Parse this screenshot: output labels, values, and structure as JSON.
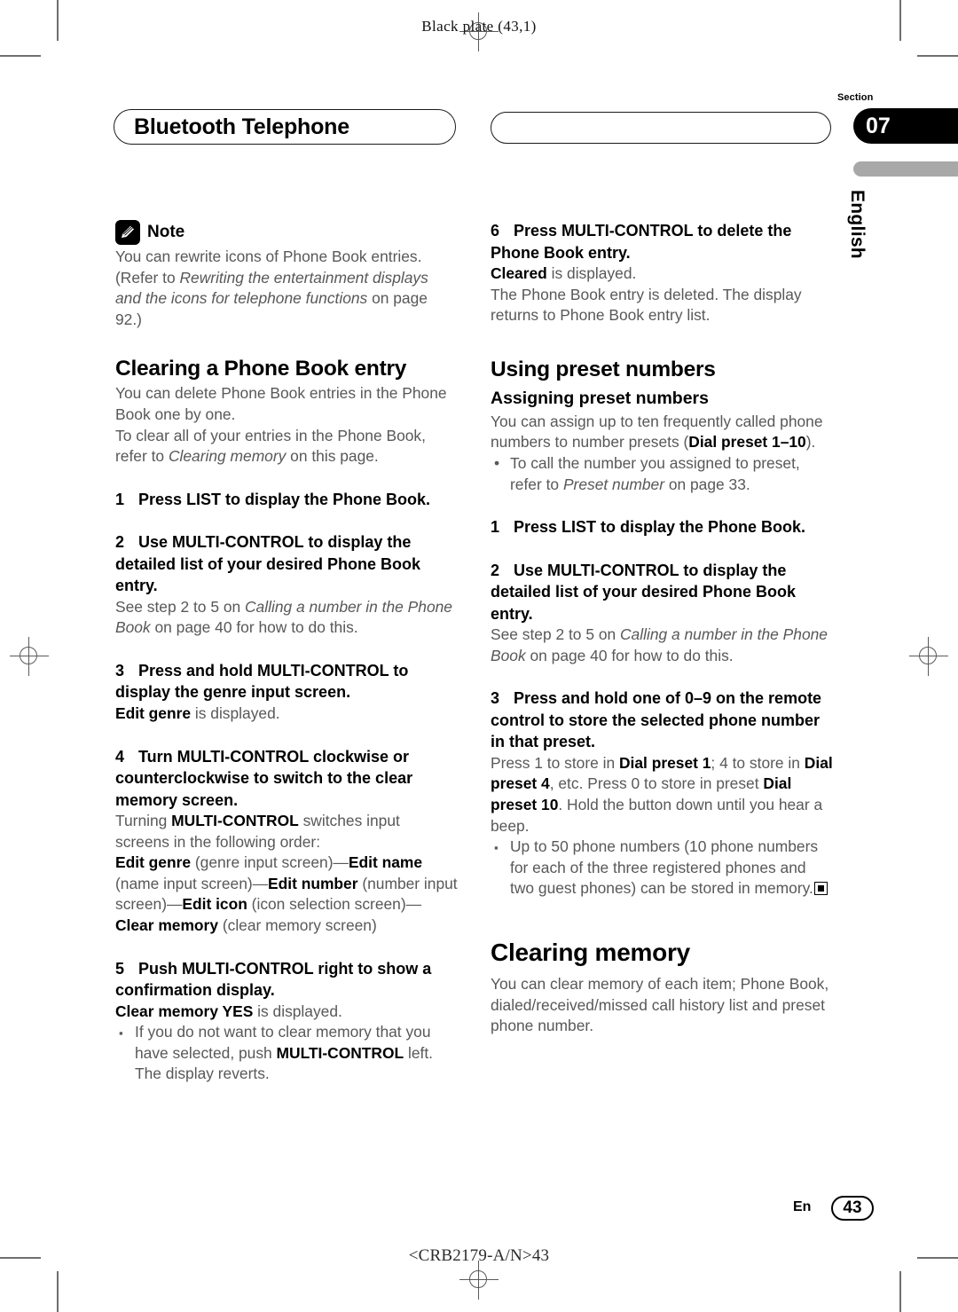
{
  "print_marks": {
    "plate_slug": "Black plate (43,1)",
    "footer_code": "<CRB2179-A/N>43"
  },
  "header": {
    "chapter_title": "Bluetooth Telephone",
    "section_label": "Section",
    "section_number": "07",
    "language": "English"
  },
  "left_column": {
    "note": {
      "icon": "pencil-note-icon",
      "label": "Note",
      "line1": "You can rewrite icons of Phone Book entries.",
      "line2_pre": "(Refer to ",
      "line2_italic": "Rewriting the entertainment displays and the icons for telephone functions",
      "line2_post": " on page 92.)"
    },
    "section_heading": "Clearing a Phone Book entry",
    "intro1": "You can delete Phone Book entries in the Phone Book one by one.",
    "intro2_pre": "To clear all of your entries in the Phone Book, refer to ",
    "intro2_italic": "Clearing memory",
    "intro2_post": " on this page.",
    "steps": [
      {
        "num": "1",
        "title": "Press LIST to display the Phone Book."
      },
      {
        "num": "2",
        "title": "Use MULTI-CONTROL to display the detailed list of your desired Phone Book entry.",
        "body_pre": "See step 2 to 5 on ",
        "body_italic": "Calling a number in the Phone Book",
        "body_post": " on page 40 for how to do this."
      },
      {
        "num": "3",
        "title": "Press and hold MULTI-CONTROL to display the genre input screen.",
        "body_bold": "Edit genre",
        "body_post": " is displayed."
      },
      {
        "num": "4",
        "title": "Turn MULTI-CONTROL clockwise or counterclockwise to switch to the clear memory screen.",
        "body_a_pre": "Turning ",
        "body_a_bold": "MULTI-CONTROL",
        "body_a_post": " switches input screens in the following order:",
        "order": [
          {
            "bold": "Edit genre",
            "plain": " (genre input screen)—"
          },
          {
            "bold": "Edit name",
            "plain": " (name input screen)—"
          },
          {
            "bold": "Edit number",
            "plain": " (number input screen)—"
          },
          {
            "bold": "Edit icon",
            "plain": " (icon selection screen)—"
          },
          {
            "bold": "Clear memory",
            "plain": " (clear memory screen)"
          }
        ]
      },
      {
        "num": "5",
        "title": "Push MULTI-CONTROL right to show a confirmation display.",
        "body_bold": "Clear memory YES",
        "body_post": " is displayed.",
        "bullet_marker": "▪",
        "bullet_pre": "If you do not want to clear memory that you have selected, push ",
        "bullet_bold": "MULTI-CONTROL",
        "bullet_post": " left. The display reverts."
      }
    ]
  },
  "right_column": {
    "step6": {
      "num": "6",
      "title": "Press MULTI-CONTROL to delete the Phone Book entry.",
      "body_bold": "Cleared",
      "body_post": " is displayed.",
      "body_line2": "The Phone Book entry is deleted. The display returns to Phone Book entry list."
    },
    "section_heading": "Using preset numbers",
    "sub_heading": "Assigning preset numbers",
    "intro_pre": "You can assign up to ten frequently called phone numbers to number presets (",
    "intro_bold": "Dial preset 1–10",
    "intro_post": ").",
    "intro_bullet_marker": "•",
    "intro_bullet_pre": "To call the number you assigned to preset, refer to ",
    "intro_bullet_italic": "Preset number",
    "intro_bullet_post": " on page 33.",
    "steps": [
      {
        "num": "1",
        "title": "Press LIST to display the Phone Book."
      },
      {
        "num": "2",
        "title": "Use MULTI-CONTROL to display the detailed list of your desired Phone Book entry.",
        "body_pre": "See step 2 to 5 on ",
        "body_italic": "Calling a number in the Phone Book",
        "body_post": " on page 40 for how to do this."
      },
      {
        "num": "3",
        "title": "Press and hold one of 0–9 on the remote control to store the selected phone number in that preset.",
        "body_p1": "Press 1 to store in ",
        "body_b1": "Dial preset 1",
        "body_p2": "; 4 to store in ",
        "body_b2": "Dial preset 4",
        "body_p3": ", etc. Press 0 to store in preset ",
        "body_b3": "Dial preset 10",
        "body_p4": ". Hold the button down until you hear a beep.",
        "bullet_marker": "▪",
        "bullet_text": "Up to 50 phone numbers (10 phone numbers for each of the three registered phones and two guest phones) can be stored in memory."
      }
    ],
    "clearing_heading": "Clearing memory",
    "clearing_body": "You can clear memory of each item; Phone Book, dialed/received/missed call history list and preset phone number."
  },
  "footer": {
    "language_code": "En",
    "page_number": "43"
  }
}
